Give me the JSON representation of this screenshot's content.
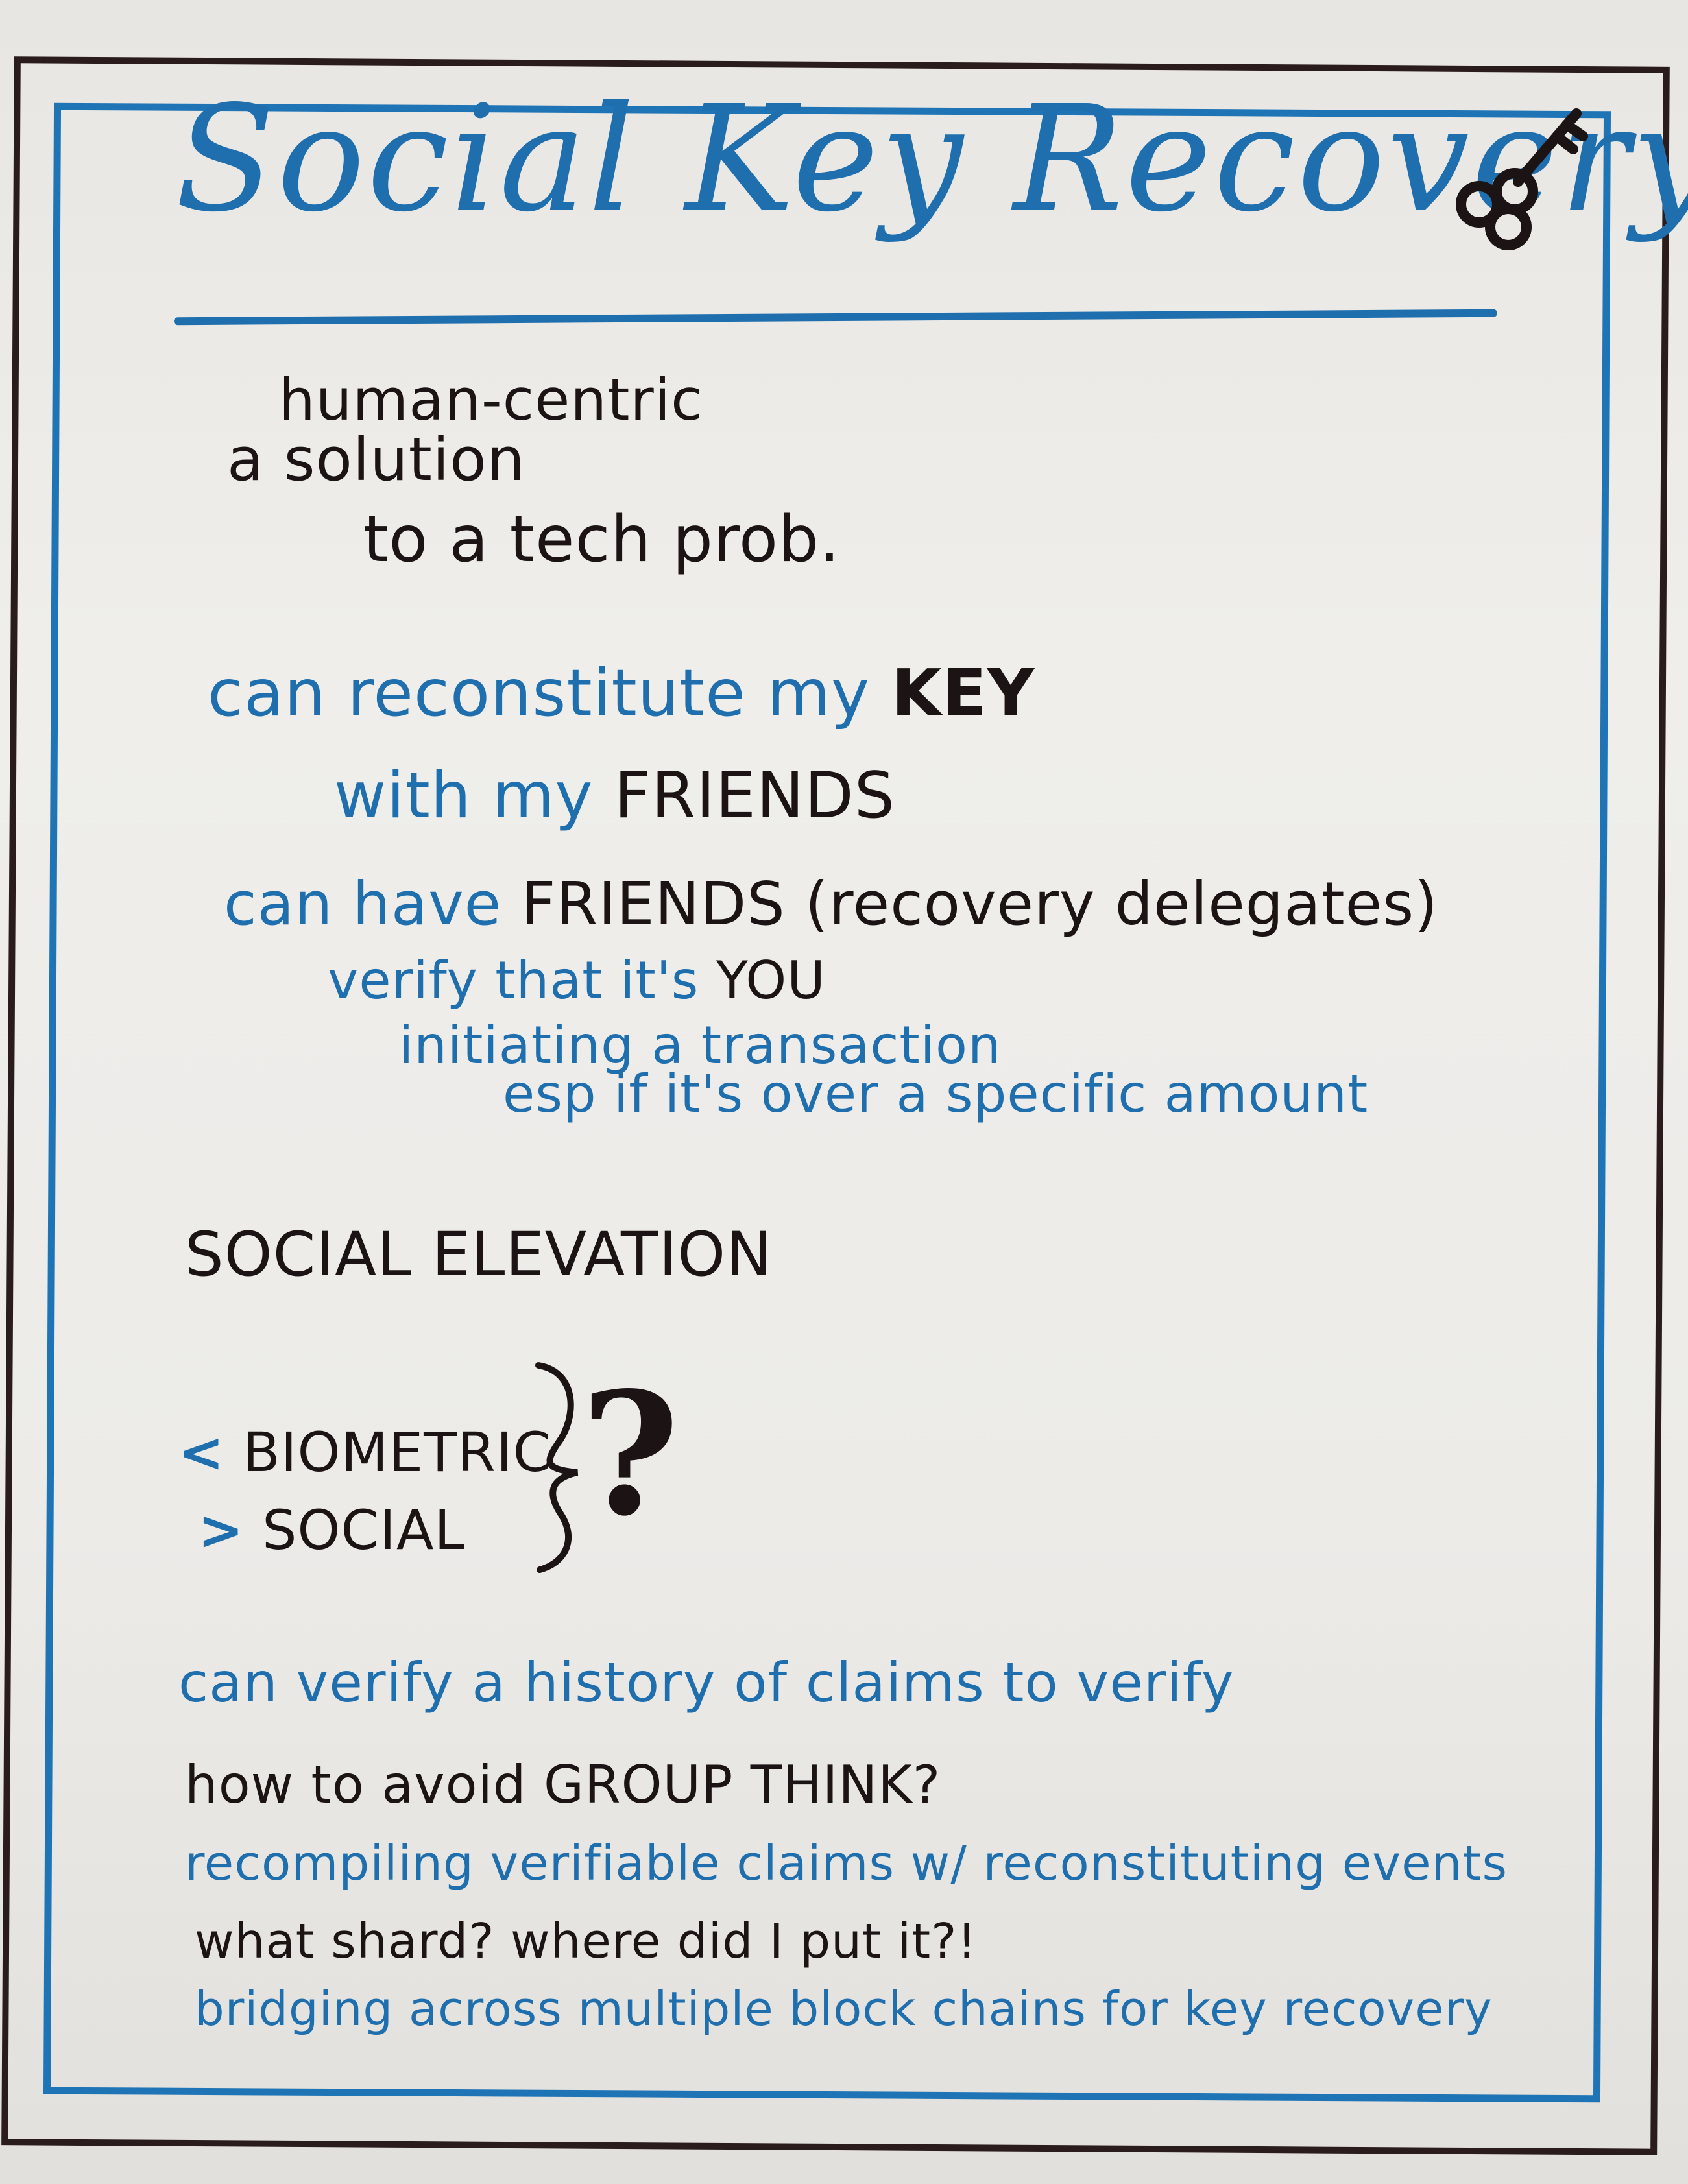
{
  "title": "Social Key Recovery",
  "key_icon": "skeleton-key-icon",
  "intro": {
    "insert": "human-centric",
    "line1": "a solution",
    "line2": "to a tech prob."
  },
  "friends_key": {
    "line1_blue": "can reconstitute my",
    "line1_dark": "KEY",
    "line2_blue": "with my",
    "line2_dark": "FRIENDS"
  },
  "delegates": {
    "line1_blue": "can have",
    "line1_dark": "FRIENDS (recovery delegates)",
    "line2_blue": "verify that it's",
    "line2_dark": "YOU",
    "line3": "initiating a transaction",
    "line4": "esp if it's over a specific amount"
  },
  "social_elevation": "SOCIAL ELEVATION",
  "comparison": {
    "less_symbol": "<",
    "biometric": "BIOMETRIC",
    "greater_symbol": ">",
    "social": "SOCIAL",
    "question": "?"
  },
  "notes": [
    "can verify a history of claims to verify",
    "how to avoid GROUP THINK?",
    "recompiling verifiable claims w/ reconstituting events",
    "what shard? where did I put it?!",
    "bridging across multiple block chains for key recovery"
  ],
  "colors": {
    "blue_marker": "#1f6fae",
    "black_marker": "#1c1414",
    "frame_blue": "#1f74b5",
    "frame_dark": "#2a1c1c"
  }
}
